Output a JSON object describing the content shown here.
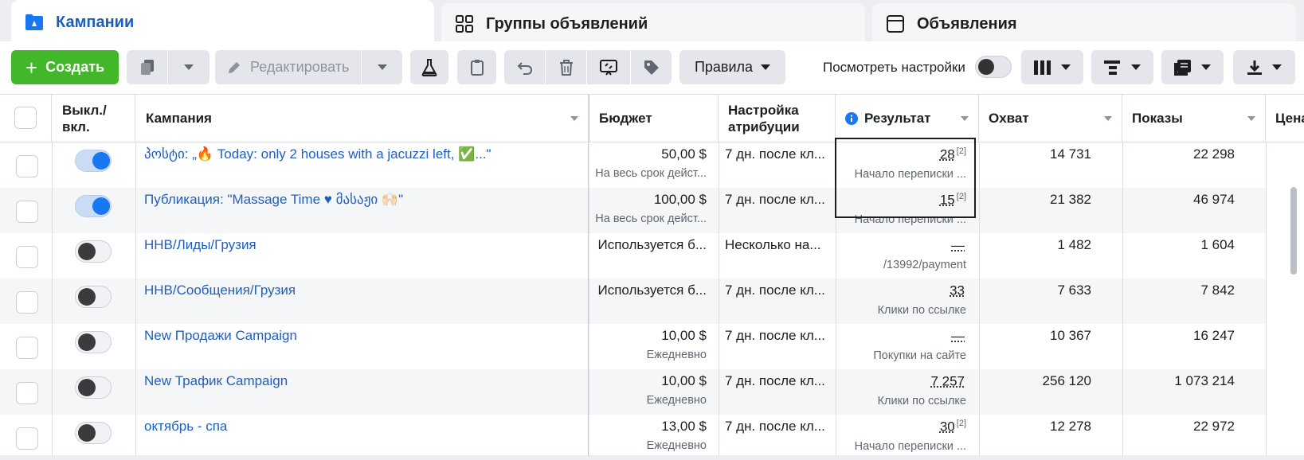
{
  "tabs": {
    "campaigns": "Кампании",
    "adsets": "Группы объявлений",
    "ads": "Объявления"
  },
  "toolbar": {
    "create": "Создать",
    "edit": "Редактировать",
    "rules": "Правила",
    "view_settings": "Посмотреть настройки"
  },
  "columns": {
    "toggle": "Выкл./ вкл.",
    "campaign": "Кампания",
    "budget": "Бюджет",
    "attribution": "Настройка атрибуции",
    "result": "Результат",
    "reach": "Охват",
    "impressions": "Показы",
    "price_partial": "Цена"
  },
  "rows": [
    {
      "on": true,
      "name": "პოსტი: „🔥 Today: only 2 houses with a jacuzzi left, ✅...\"",
      "budget": "50,00 $",
      "budget_sub": "На весь срок дейст...",
      "attribution": "7 дн. после кл...",
      "result": "28",
      "result_ref": "[2]",
      "result_sub": "Начало переписки ...",
      "reach": "14 731",
      "impressions": "22 298"
    },
    {
      "on": true,
      "name": "Публикация: \"Massage Time ♥ მასაჟი 🙌🏻\"",
      "budget": "100,00 $",
      "budget_sub": "На весь срок дейст...",
      "attribution": "7 дн. после кл...",
      "result": "15",
      "result_ref": "[2]",
      "result_sub": "Начало переписки ...",
      "reach": "21 382",
      "impressions": "46 974"
    },
    {
      "on": false,
      "name": "HHB/Лиды/Грузия",
      "budget": "Используется б...",
      "budget_sub": "",
      "attribution": "Несколько на...",
      "result": "—",
      "result_ref": "",
      "result_sub": "/13992/payment",
      "reach": "1 482",
      "impressions": "1 604"
    },
    {
      "on": false,
      "name": "HHB/Сообщения/Грузия",
      "budget": "Используется б...",
      "budget_sub": "",
      "attribution": "7 дн. после кл...",
      "result": "33",
      "result_ref": "",
      "result_sub": "Клики по ссылке",
      "reach": "7 633",
      "impressions": "7 842"
    },
    {
      "on": false,
      "name": "New Продажи Campaign",
      "budget": "10,00 $",
      "budget_sub": "Ежедневно",
      "attribution": "7 дн. после кл...",
      "result": "—",
      "result_ref": "",
      "result_sub": "Покупки на сайте",
      "reach": "10 367",
      "impressions": "16 247"
    },
    {
      "on": false,
      "name": "New Трафик Campaign",
      "budget": "10,00 $",
      "budget_sub": "Ежедневно",
      "attribution": "7 дн. после кл...",
      "result": "7 257",
      "result_ref": "",
      "result_sub": "Клики по ссылке",
      "reach": "256 120",
      "impressions": "1 073 214"
    },
    {
      "on": false,
      "name": "октябрь - спа",
      "budget": "13,00 $",
      "budget_sub": "Ежедневно",
      "attribution": "7 дн. после кл...",
      "result": "30",
      "result_ref": "[2]",
      "result_sub": "Начало переписки ...",
      "reach": "12 278",
      "impressions": "22 972"
    }
  ],
  "colors": {
    "accent": "#1d5fc1",
    "create": "#42b72a",
    "toggle_on": "#1877f2"
  }
}
